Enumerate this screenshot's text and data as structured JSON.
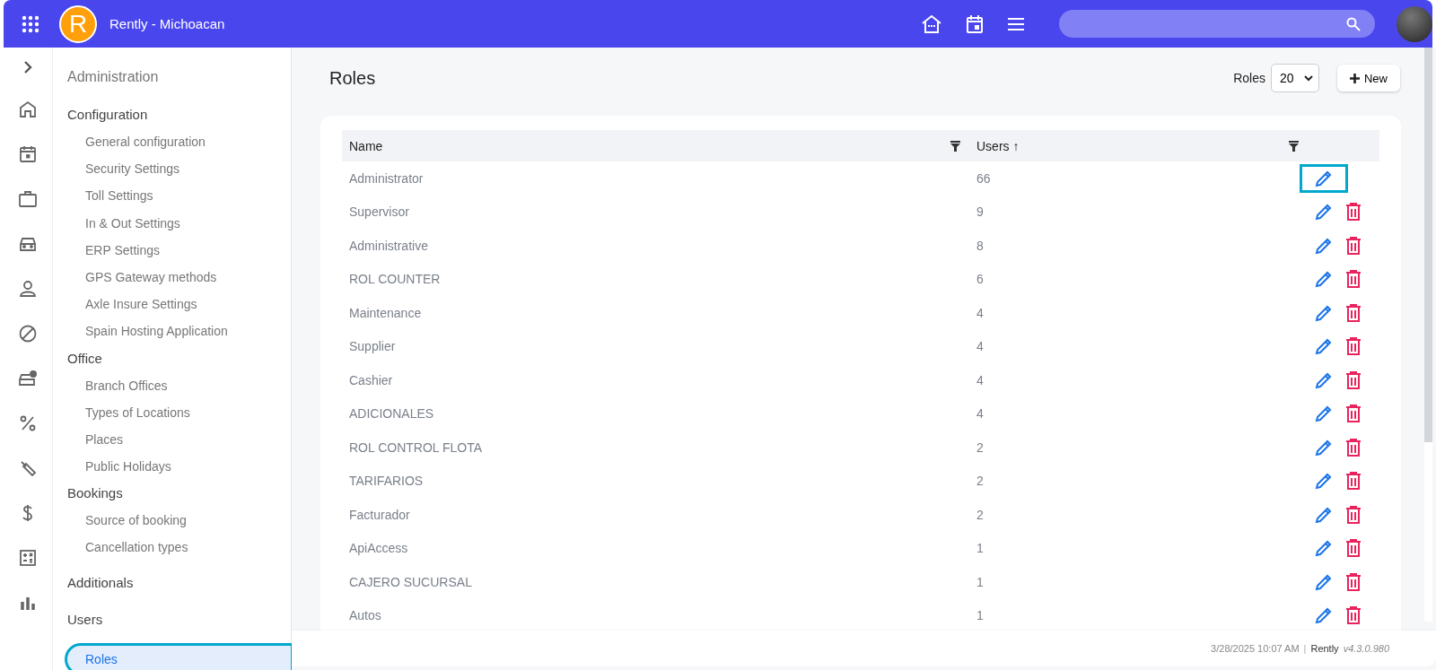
{
  "topbar": {
    "logo_letter": "R",
    "title": "Rently - Michoacan"
  },
  "sidebar": {
    "title": "Administration",
    "sections": [
      {
        "label": "Configuration",
        "items": [
          {
            "label": "General configuration",
            "selected": false,
            "highlighted": false
          },
          {
            "label": "Security Settings",
            "selected": false,
            "highlighted": false
          },
          {
            "label": "Toll Settings",
            "selected": false,
            "highlighted": false
          },
          {
            "label": "In & Out Settings",
            "selected": false,
            "highlighted": false
          },
          {
            "label": "ERP Settings",
            "selected": false,
            "highlighted": false
          },
          {
            "label": "GPS Gateway methods",
            "selected": false,
            "highlighted": false
          },
          {
            "label": "Axle Insure Settings",
            "selected": false,
            "highlighted": false
          },
          {
            "label": "Spain Hosting Application",
            "selected": false,
            "highlighted": false
          }
        ]
      },
      {
        "label": "Office",
        "items": [
          {
            "label": "Branch Offices",
            "selected": false,
            "highlighted": false
          },
          {
            "label": "Types of Locations",
            "selected": false,
            "highlighted": false
          },
          {
            "label": "Places",
            "selected": false,
            "highlighted": false
          },
          {
            "label": "Public Holidays",
            "selected": false,
            "highlighted": false
          }
        ]
      },
      {
        "label": "Bookings",
        "items": [
          {
            "label": "Source of booking",
            "selected": false,
            "highlighted": false
          },
          {
            "label": "Cancellation types",
            "selected": false,
            "highlighted": false
          }
        ]
      },
      {
        "label": "Additionals"
      },
      {
        "label": "Users",
        "items": [
          {
            "label": "Roles",
            "selected": true,
            "highlighted": true
          }
        ]
      }
    ]
  },
  "page": {
    "title": "Roles",
    "page_size": {
      "label": "Roles",
      "value": "20"
    },
    "new_button": "New"
  },
  "table": {
    "columns": [
      {
        "label": "Name",
        "filter": true
      },
      {
        "label": "Users ↑",
        "filter": true
      }
    ],
    "rows": [
      {
        "name": "Administrator",
        "users": "66",
        "deletable": false,
        "highlighted": true
      },
      {
        "name": "Supervisor",
        "users": "9",
        "deletable": true,
        "highlighted": false
      },
      {
        "name": "Administrative",
        "users": "8",
        "deletable": true,
        "highlighted": false
      },
      {
        "name": "ROL COUNTER",
        "users": "6",
        "deletable": true,
        "highlighted": false
      },
      {
        "name": "Maintenance",
        "users": "4",
        "deletable": true,
        "highlighted": false
      },
      {
        "name": "Supplier",
        "users": "4",
        "deletable": true,
        "highlighted": false
      },
      {
        "name": "Cashier",
        "users": "4",
        "deletable": true,
        "highlighted": false
      },
      {
        "name": "ADICIONALES",
        "users": "4",
        "deletable": true,
        "highlighted": false
      },
      {
        "name": "ROL CONTROL FLOTA",
        "users": "2",
        "deletable": true,
        "highlighted": false
      },
      {
        "name": "TARIFARIOS",
        "users": "2",
        "deletable": true,
        "highlighted": false
      },
      {
        "name": "Facturador",
        "users": "2",
        "deletable": true,
        "highlighted": false
      },
      {
        "name": "ApiAccess",
        "users": "1",
        "deletable": true,
        "highlighted": false
      },
      {
        "name": "CAJERO SUCURSAL",
        "users": "1",
        "deletable": true,
        "highlighted": false
      },
      {
        "name": "Autos",
        "users": "1",
        "deletable": true,
        "highlighted": false
      }
    ]
  },
  "footer": {
    "datetime": "3/28/2025 10:07 AM",
    "separator": "|",
    "brand": "Rently",
    "version": "v4.3.0.980"
  }
}
